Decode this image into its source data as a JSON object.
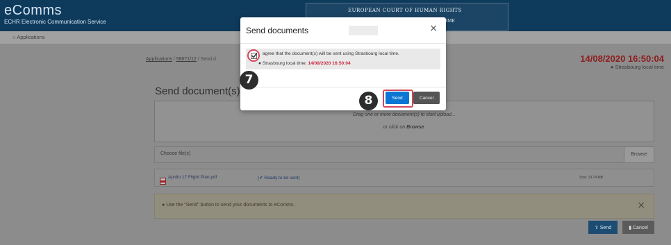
{
  "header": {
    "brand_name": "eComms",
    "brand_sub": "ECHR Electronic Communication Service",
    "court_line1": "EUROPEAN COURT OF HUMAN RIGHTS",
    "court_line2": "HME"
  },
  "subbar": {
    "crumb": "Applications"
  },
  "breadcrumb": {
    "applications": "Applications",
    "sep1": "/",
    "application_no": "58671/12",
    "sep2": "/",
    "current": "Send d"
  },
  "timebox": {
    "time": "14/08/2020 16:50:04",
    "label": "Strasbourg local time"
  },
  "page": {
    "title": "Send document(s)",
    "drop_text": "Drag one or more document(s) to start upload...",
    "drop_or": "or click on ",
    "drop_browse": "Browse",
    "drop_end": ".",
    "choose_label": "Choose file(s)",
    "browse_button": "Browse",
    "file_name": "Apollo 17 Flight Plan.pdf",
    "file_status": "(✔ Ready to be sent)",
    "file_size": "Size: 19.74 MB",
    "alert_message": "Use the \"Send\" button to send your documents to eComms.",
    "alert_close": "×",
    "send_button": "Send",
    "cancel_button": "Cancel"
  },
  "modal": {
    "title": "Send documents",
    "close": "×",
    "agree_text": "agree that the document(s) will be sent using Strasbourg local time.",
    "local_label": "Strasbourg local time:",
    "local_time": "14/08/2020 16:50:04",
    "send": "Send",
    "cancel": "Cancel"
  },
  "steps": {
    "seven": "7",
    "eight": "8"
  },
  "colors": {
    "accent_red": "#cc2b43",
    "primary_blue": "#0b76d3",
    "header_navy": "#0e3a5c"
  }
}
